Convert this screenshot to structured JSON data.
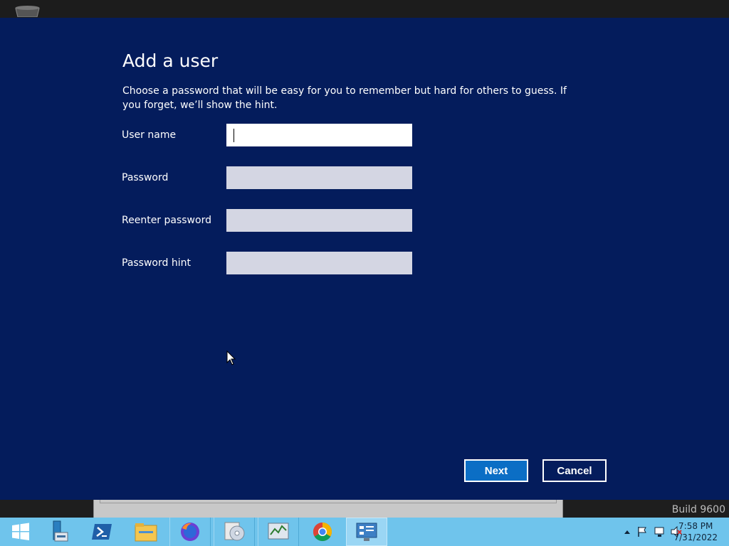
{
  "dialog": {
    "title": "Add a user",
    "description": "Choose a password that will be easy for you to remember but hard for others to guess. If you forget, we’ll show the hint.",
    "fields": [
      {
        "label": "User name",
        "value": ""
      },
      {
        "label": "Password",
        "value": ""
      },
      {
        "label": "Reenter password",
        "value": ""
      },
      {
        "label": "Password hint",
        "value": ""
      }
    ],
    "next_label": "Next",
    "cancel_label": "Cancel"
  },
  "desktop": {
    "build_text": "Build 9600"
  },
  "taskbar": {
    "items": [
      "start-icon",
      "server-manager-icon",
      "powershell-icon",
      "file-explorer-icon",
      "firefox-icon",
      "disc-burner-icon",
      "performance-monitor-icon",
      "chrome-icon",
      "control-panel-icon"
    ],
    "time": "7:58 PM",
    "date": "7/31/2022"
  },
  "colors": {
    "panel_bg": "#041c5c",
    "next_bg": "#0b6ec5",
    "taskbar_bg": "#6fc4ec"
  }
}
